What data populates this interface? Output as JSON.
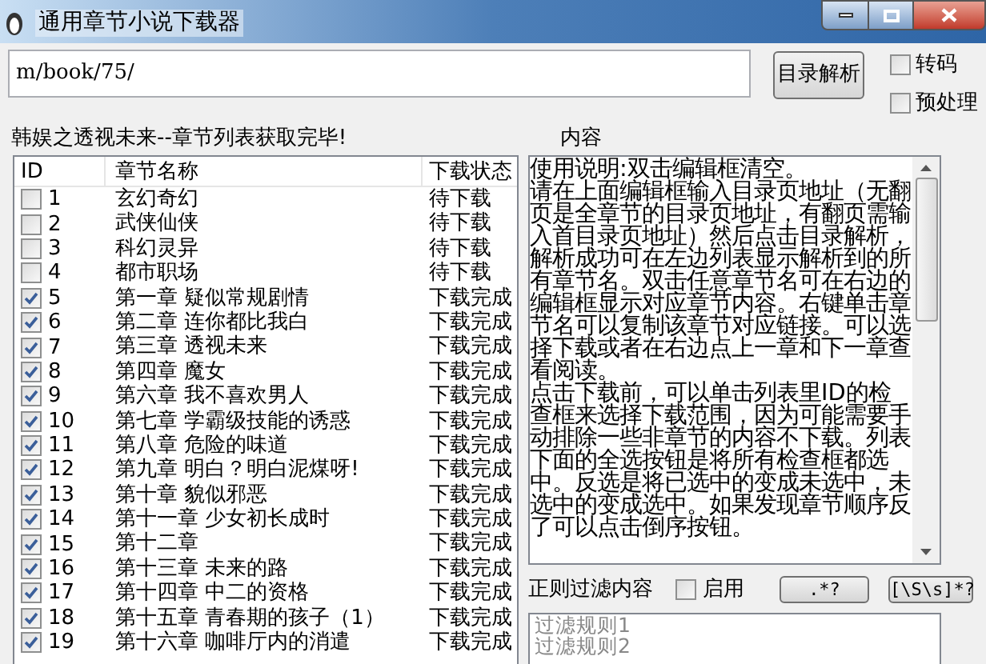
{
  "window": {
    "title": "通用章节小说下载器"
  },
  "url_field": {
    "value": "m/book/75/"
  },
  "parse_button": "目录解析",
  "options": [
    {
      "label": "转码",
      "checked": false
    },
    {
      "label": "预处理",
      "checked": false
    }
  ],
  "status": "韩娱之透视未来--章节列表获取完毕!",
  "content_label": "内容",
  "table": {
    "columns": [
      "ID",
      "章节名称",
      "下载状态"
    ],
    "rows": [
      {
        "id": "1",
        "name": "玄幻奇幻",
        "status": "待下载",
        "checked": false
      },
      {
        "id": "2",
        "name": "武侠仙侠",
        "status": "待下载",
        "checked": false
      },
      {
        "id": "3",
        "name": "科幻灵异",
        "status": "待下载",
        "checked": false
      },
      {
        "id": "4",
        "name": "都市职场",
        "status": "待下载",
        "checked": false
      },
      {
        "id": "5",
        "name": "第一章 疑似常规剧情",
        "status": "下载完成",
        "checked": true
      },
      {
        "id": "6",
        "name": "第二章 连你都比我白",
        "status": "下载完成",
        "checked": true
      },
      {
        "id": "7",
        "name": "第三章 透视未来",
        "status": "下载完成",
        "checked": true
      },
      {
        "id": "8",
        "name": "第四章 魔女",
        "status": "下载完成",
        "checked": true
      },
      {
        "id": "9",
        "name": "第六章 我不喜欢男人",
        "status": "下载完成",
        "checked": true
      },
      {
        "id": "10",
        "name": "第七章 学霸级技能的诱惑",
        "status": "下载完成",
        "checked": true
      },
      {
        "id": "11",
        "name": "第八章 危险的味道",
        "status": "下载完成",
        "checked": true
      },
      {
        "id": "12",
        "name": "第九章 明白？明白泥煤呀!",
        "status": "下载完成",
        "checked": true
      },
      {
        "id": "13",
        "name": "第十章 貌似邪恶",
        "status": "下载完成",
        "checked": true
      },
      {
        "id": "14",
        "name": "第十一章 少女初长成时",
        "status": "下载完成",
        "checked": true
      },
      {
        "id": "15",
        "name": "第十二章",
        "status": "下载完成",
        "checked": true
      },
      {
        "id": "16",
        "name": "第十三章 未来的路",
        "status": "下载完成",
        "checked": true
      },
      {
        "id": "17",
        "name": "第十四章 中二的资格",
        "status": "下载完成",
        "checked": true
      },
      {
        "id": "18",
        "name": "第十五章 青春期的孩子（1）",
        "status": "下载完成",
        "checked": true
      },
      {
        "id": "19",
        "name": "第十六章 咖啡厅内的消遣",
        "status": "下载完成",
        "checked": true
      }
    ]
  },
  "content": [
    "使用说明:双击编辑框清空。",
    "请在上面编辑框输入目录页地址（无翻页是全章节的目录页地址，有翻页需输入首目录页地址）然后点击目录解析，解析成功可在左边列表显示解析到的所有章节名。双击任意章节名可在右边的编辑框显示对应章节内容。右键单击章节名可以复制该章节对应链接。可以选择下载或者在右边点上一章和下一章查看阅读。",
    "点击下载前，可以单击列表里ID的检查框来选择下载范围，因为可能需要手动排除一些非章节的内容不下载。列表下面的全选按钮是将所有检查框都选中。反选是将已选中的变成未选中，未选中的变成选中。如果发现章节顺序反了可以点击倒序按钮。"
  ],
  "filter": {
    "label": "正则过滤内容",
    "enable": {
      "label": "启用",
      "checked": false
    },
    "buttons": [
      ".*?",
      "[\\S\\s]*?"
    ],
    "rules": [
      "过滤规则1",
      "过滤规则2"
    ]
  }
}
